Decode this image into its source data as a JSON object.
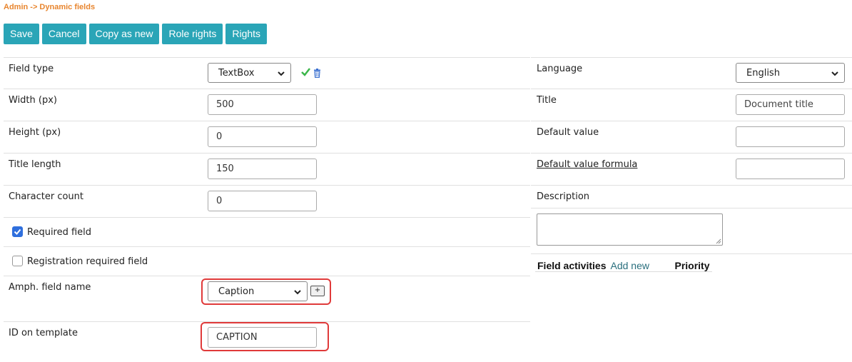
{
  "breadcrumb": "Admin -> Dynamic fields",
  "toolbar": {
    "save": "Save",
    "cancel": "Cancel",
    "copy": "Copy as new",
    "role_rights": "Role rights",
    "rights": "Rights"
  },
  "left": {
    "field_type": {
      "label": "Field type",
      "value": "TextBox"
    },
    "width": {
      "label": "Width (px)",
      "value": "500"
    },
    "height": {
      "label": "Height (px)",
      "value": "0"
    },
    "title_length": {
      "label": "Title length",
      "value": "150"
    },
    "character_count": {
      "label": "Character count",
      "value": "0"
    },
    "required_field": {
      "label": "Required field",
      "checked": true
    },
    "registration_required": {
      "label": "Registration required field",
      "checked": false
    },
    "amph_field_name": {
      "label": "Amph. field name",
      "value": "Caption",
      "add": "+"
    },
    "id_on_template": {
      "label": "ID on template",
      "value": "CAPTION"
    }
  },
  "right": {
    "language": {
      "label": "Language",
      "value": "English"
    },
    "title": {
      "label": "Title",
      "placeholder": "Document title"
    },
    "default_value": {
      "label": "Default value",
      "value": ""
    },
    "default_value_formula": {
      "label": "Default value formula",
      "value": ""
    },
    "description": {
      "label": "Description"
    },
    "activities": {
      "field_activities": "Field activities",
      "add_new": "Add new",
      "priority": "Priority"
    }
  },
  "colors": {
    "accent": "#2aa5b7",
    "breadcrumb": "#e8852e",
    "highlight": "#e03a3a"
  }
}
